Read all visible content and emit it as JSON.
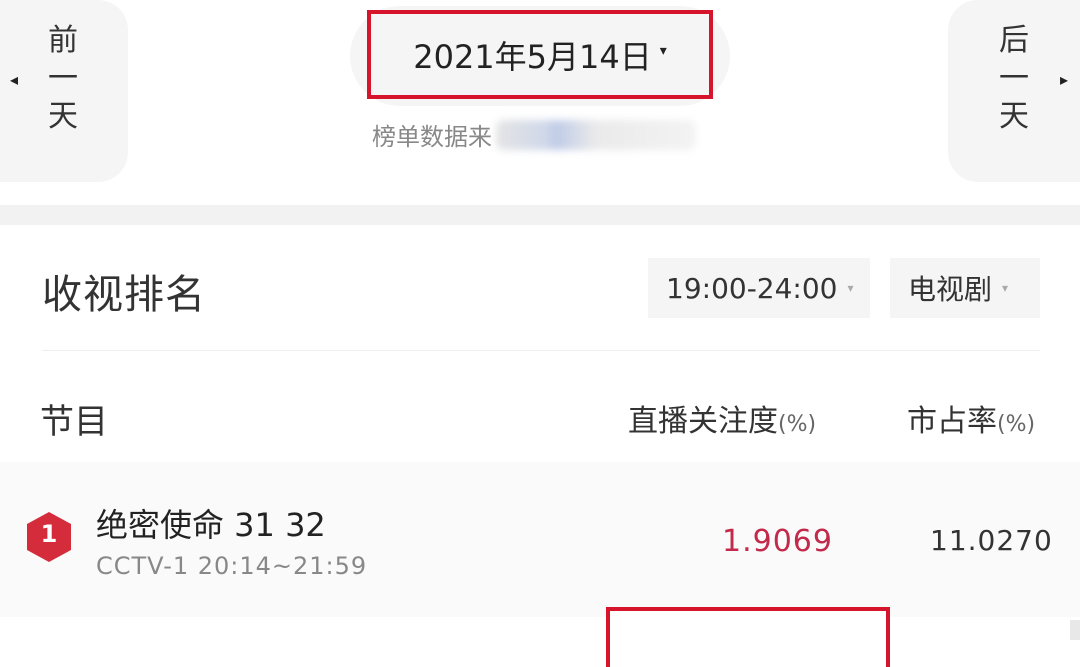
{
  "header": {
    "prev_day_chars": [
      "前",
      "一",
      "天"
    ],
    "next_day_chars": [
      "后",
      "一",
      "天"
    ],
    "date": "2021年5月14日",
    "date_caret": "▾",
    "source_label": "榜单数据来",
    "prev_arrow": "◂",
    "next_arrow": "▸"
  },
  "ratings": {
    "title": "收视排名",
    "filters": {
      "time": "19:00-24:00",
      "genre": "电视剧",
      "caret": "▾"
    },
    "columns": {
      "program": "节目",
      "focus": "直播关注度",
      "share": "市占率",
      "unit": "(%)"
    },
    "rows": [
      {
        "rank": "1",
        "title": "绝密使命 31 32",
        "channel_time": "CCTV-1 20:14~21:59",
        "focus": "1.9069",
        "share": "11.0270"
      }
    ]
  },
  "colors": {
    "highlight_border": "#d6152c",
    "focus_value": "#c2294a",
    "rank_badge": "#d42c3a"
  }
}
